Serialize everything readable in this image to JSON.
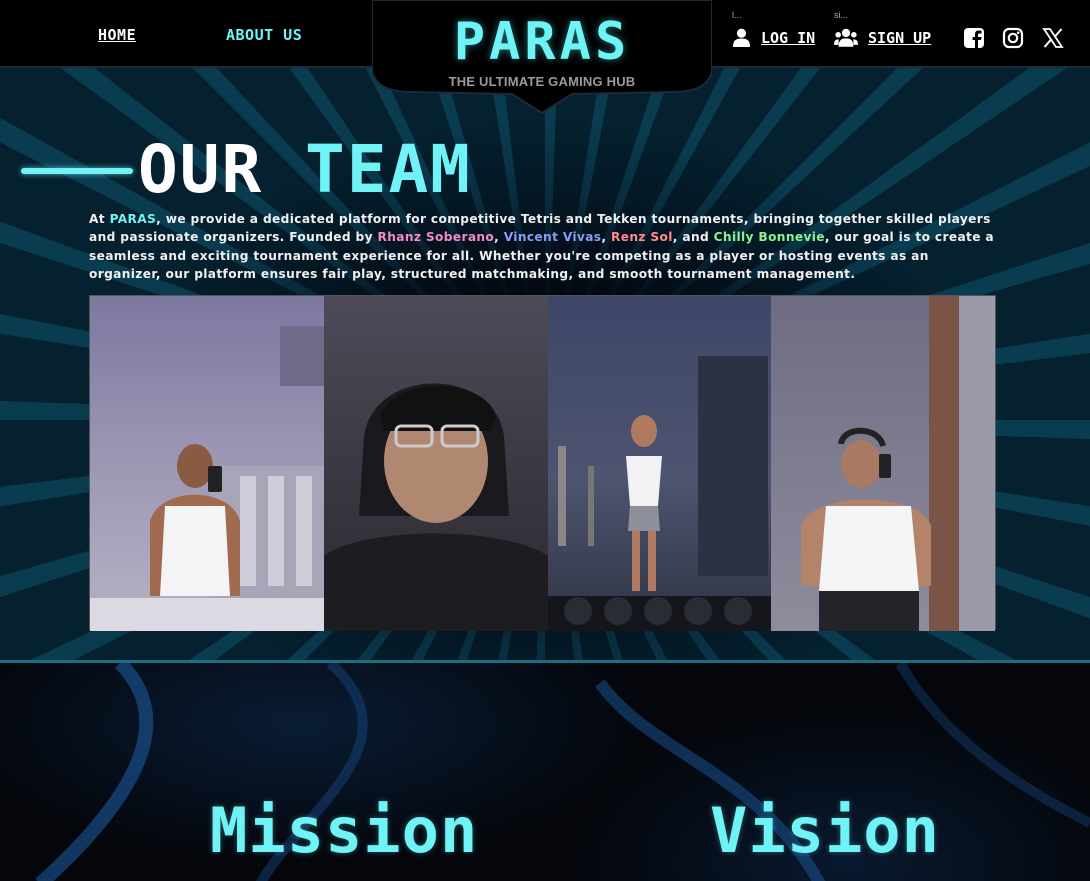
{
  "header": {
    "nav": {
      "home": "HOME",
      "about": "ABOUT US"
    },
    "logo": {
      "title": "PARAS",
      "subtitle": "THE ULTIMATE GAMING HUB"
    },
    "auth": {
      "login_small": "l...",
      "login_label": "LOG IN",
      "signup_small": "si...",
      "signup_label": "SIGN UP"
    },
    "social_icons": [
      "facebook-square-icon",
      "instagram-icon",
      "x-icon"
    ]
  },
  "team": {
    "title_part1": "OUR",
    "title_part2": "TEAM",
    "intro_start": "At ",
    "brand": "PARAS",
    "intro_mid": ", we provide a dedicated platform for competitive Tetris and Tekken tournaments, bringing together skilled players and passionate organizers. Founded by ",
    "founders": [
      "Rhanz Soberano",
      "Vincent Vivas",
      "Renz Sol",
      "Chilly Bonnevie"
    ],
    "sep1": ", ",
    "sep2": ", ",
    "sep3": ", and ",
    "intro_end": ", our goal is to create a seamless and exciting tournament experience for all. Whether you're competing as a player or hosting events as an organizer, our platform ensures fair play, structured matchmaking, and smooth tournament management."
  },
  "sections": {
    "mission": "Mission",
    "vision": "Vision"
  },
  "colors": {
    "accent": "#6ff3f6",
    "founder_1": "#f48ac6",
    "founder_2": "#8a9cf7",
    "founder_3": "#ff8a8a",
    "founder_4": "#8ff28f",
    "background": "#05070c"
  }
}
